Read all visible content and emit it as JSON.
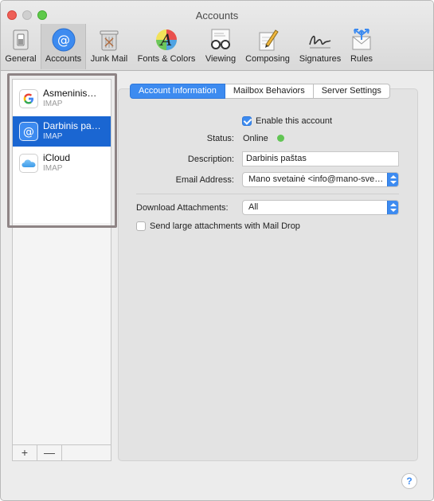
{
  "window": {
    "title": "Accounts"
  },
  "toolbar": {
    "items": [
      {
        "label": "General",
        "icon": "general-switch-icon"
      },
      {
        "label": "Accounts",
        "icon": "at-sign-icon",
        "selected": true
      },
      {
        "label": "Junk Mail",
        "icon": "trash-bin-icon"
      },
      {
        "label": "Fonts & Colors",
        "icon": "fonts-colors-icon"
      },
      {
        "label": "Viewing",
        "icon": "glasses-icon"
      },
      {
        "label": "Composing",
        "icon": "pencil-icon"
      },
      {
        "label": "Signatures",
        "icon": "signature-icon"
      },
      {
        "label": "Rules",
        "icon": "rules-arrows-icon"
      }
    ]
  },
  "sidebar": {
    "accounts": [
      {
        "name": "Asmeninis…",
        "type": "IMAP",
        "icon": "google-icon",
        "selected": false
      },
      {
        "name": "Darbinis pa…",
        "type": "IMAP",
        "icon": "at-sign-icon",
        "selected": true
      },
      {
        "name": "iCloud",
        "type": "IMAP",
        "icon": "icloud-icon",
        "selected": false
      }
    ],
    "add_label": "+",
    "remove_label": "—"
  },
  "tabs": [
    {
      "label": "Account Information",
      "active": true
    },
    {
      "label": "Mailbox Behaviors",
      "active": false
    },
    {
      "label": "Server Settings",
      "active": false
    }
  ],
  "form": {
    "enable_label": "Enable this account",
    "enable_checked": true,
    "status_label": "Status:",
    "status_value": "Online",
    "description_label": "Description:",
    "description_value": "Darbinis paštas",
    "email_label": "Email Address:",
    "email_value": "Mano svetainė <info@mano-sve…",
    "download_label": "Download Attachments:",
    "download_value": "All",
    "maildrop_label": "Send large attachments with Mail Drop",
    "maildrop_checked": false
  },
  "help_label": "?",
  "colors": {
    "accent": "#3d8bf0",
    "selection": "#1a66d2",
    "online": "#62c554"
  }
}
